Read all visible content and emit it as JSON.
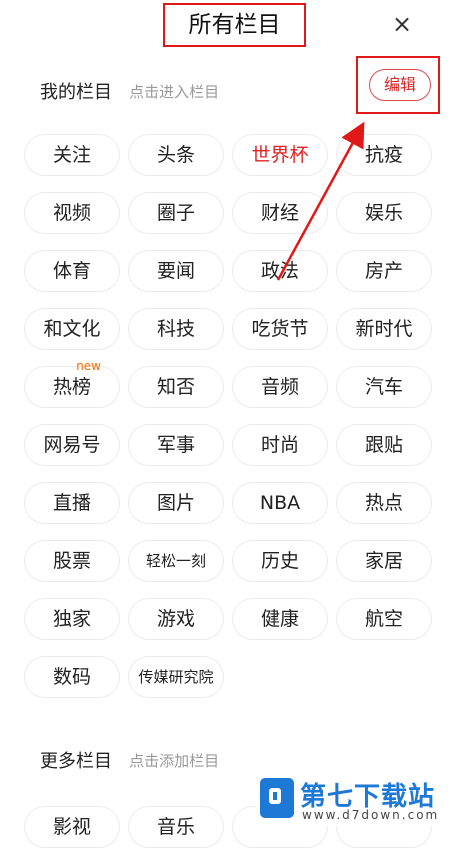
{
  "header": {
    "title": "所有栏目",
    "close_icon": "×"
  },
  "my_section": {
    "title": "我的栏目",
    "hint": "点击进入栏目",
    "edit_label": "编辑",
    "channels": [
      {
        "label": "关注"
      },
      {
        "label": "头条"
      },
      {
        "label": "世界杯",
        "active": true
      },
      {
        "label": "抗疫"
      },
      {
        "label": "视频"
      },
      {
        "label": "圈子"
      },
      {
        "label": "财经"
      },
      {
        "label": "娱乐"
      },
      {
        "label": "体育"
      },
      {
        "label": "要闻"
      },
      {
        "label": "政法"
      },
      {
        "label": "房产"
      },
      {
        "label": "和文化"
      },
      {
        "label": "科技"
      },
      {
        "label": "吃货节"
      },
      {
        "label": "新时代"
      },
      {
        "label": "热榜",
        "badge": "new"
      },
      {
        "label": "知否"
      },
      {
        "label": "音频"
      },
      {
        "label": "汽车"
      },
      {
        "label": "网易号"
      },
      {
        "label": "军事"
      },
      {
        "label": "时尚"
      },
      {
        "label": "跟贴"
      },
      {
        "label": "直播"
      },
      {
        "label": "图片"
      },
      {
        "label": "NBA"
      },
      {
        "label": "热点"
      },
      {
        "label": "股票"
      },
      {
        "label": "轻松一刻",
        "small": true
      },
      {
        "label": "历史"
      },
      {
        "label": "家居"
      },
      {
        "label": "独家"
      },
      {
        "label": "游戏"
      },
      {
        "label": "健康"
      },
      {
        "label": "航空"
      },
      {
        "label": "数码"
      },
      {
        "label": "传媒研究院",
        "small": true
      }
    ]
  },
  "more_section": {
    "title": "更多栏目",
    "hint": "点击添加栏目",
    "channels": [
      {
        "label": "影视"
      },
      {
        "label": "音乐"
      },
      {
        "label": ""
      },
      {
        "label": ""
      }
    ]
  },
  "watermark": {
    "name": "第七下载站",
    "url": "www.d7down.com"
  },
  "colors": {
    "accent": "#e02424",
    "annotation": "#e01818",
    "brand": "#1e79d6"
  }
}
